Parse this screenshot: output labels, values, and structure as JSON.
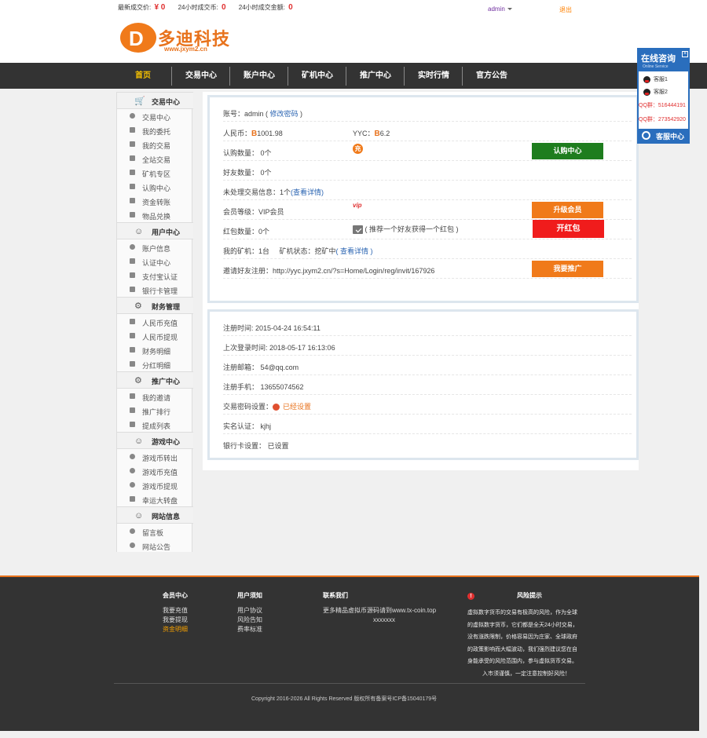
{
  "topbar": {
    "last_price_label": "最新成交价:",
    "last_price_value": "¥ 0",
    "volume_label": "24小时成交币:",
    "volume_value": "0",
    "amount_label": "24小时成交金额:",
    "amount_value": "0",
    "username": "admin",
    "logout": "退出"
  },
  "logo": {
    "letter": "D",
    "name": "多迪科技",
    "url": "www.jxym2.cn"
  },
  "nav": {
    "items": [
      "首页",
      "交易中心",
      "账户中心",
      "矿机中心",
      "推广中心",
      "实时行情",
      "官方公告"
    ]
  },
  "sidebar": {
    "sections": [
      {
        "title": "交易中心",
        "icon": "cart-icon",
        "items": [
          "交易中心",
          "我的委托",
          "我的交易",
          "全站交易",
          "矿机专区",
          "认购中心",
          "资金转账",
          "物品兑换"
        ]
      },
      {
        "title": "用户中心",
        "icon": "user-icon",
        "items": [
          "账户信息",
          "认证中心",
          "支付宝认证",
          "银行卡管理"
        ]
      },
      {
        "title": "财务管理",
        "icon": "gear-icon",
        "items": [
          "人民币充值",
          "人民币提现",
          "财务明细",
          "分红明细"
        ]
      },
      {
        "title": "推广中心",
        "icon": "gear-icon",
        "items": [
          "我的邀请",
          "推广排行",
          "提成列表"
        ]
      },
      {
        "title": "游戏中心",
        "icon": "user-icon",
        "items": [
          "游戏币转出",
          "游戏币充值",
          "游戏币提现",
          "幸运大转盘"
        ]
      },
      {
        "title": "网站信息",
        "icon": "user-icon",
        "items": [
          "留言板",
          "网站公告"
        ]
      }
    ]
  },
  "account": {
    "account_label": "账号：admin",
    "change_password": "修改密码",
    "rmb_label": "人民币：",
    "rmb_value": "1001.98",
    "yyc_label": "YYC：",
    "yyc_value": "6.2",
    "buy_count": "认购数量： 0个",
    "charge_badge": "充",
    "buy_center_btn": "认购中心",
    "friends_count": "好友数量： 0个",
    "pending_msgs": "未处理交易信息：1个",
    "view_details": "(查看详情)",
    "member_level": "会员等级：VIP会员",
    "vip_tag": "vip",
    "upgrade_btn": "升级会员",
    "redpack_count": "红包数量：0个",
    "redpack_hint": "( 推荐一个好友获得一个红包 )",
    "redpack_btn": "开红包",
    "my_miners": "我的矿机：1台",
    "miner_status": "矿机状态：挖矿中",
    "miner_details": "( 查看详情 )",
    "invite_label": "邀请好友注册：http://yyc.jxym2.cn/?s=Home/Login/reg/invit/167926",
    "promote_btn": "我要推广"
  },
  "profile": {
    "register_time": "注册时间: 2015-04-24 16:54:11",
    "last_login": "上次登录时间: 2018-05-17 16:13:06",
    "email": "注册邮箱： 54@qq.com",
    "phone": "注册手机： 13655074562",
    "trade_pwd_label": "交易密码设置：",
    "trade_pwd_status": "已经设置",
    "realname": "实名认证： kjhj",
    "bankcard": "银行卡设置： 已设置"
  },
  "consult": {
    "title": "在线咨询",
    "subtitle": "Online Service",
    "close": "×",
    "agents": [
      "客服1",
      "客服2"
    ],
    "groups": [
      "QQ群：516444191",
      "QQ群：273542920"
    ],
    "footer": "客服中心"
  },
  "footer": {
    "cols": [
      {
        "title": "会员中心",
        "links": [
          "我要充值",
          "我要提现",
          "资金明细"
        ]
      },
      {
        "title": "用户须知",
        "links": [
          "用户协议",
          "风险告知",
          "费率标准"
        ]
      },
      {
        "title": "联系我们",
        "links": [
          "更多精品虚拟币源码请到www.tx-coin.top",
          "xxxxxxx"
        ]
      }
    ],
    "risk_icon": "!",
    "risk_title": "风险提示",
    "risk_lines": [
      "虚拟数字货币的交易有极高的风险，作为全球",
      "的虚拟数字货币，它们都是全天24小时交易，",
      "没有涨跌限制，价格容易因为庄家、全球政府",
      "的政策影响而大幅波动，我们强烈建议您在自",
      "身能承受的风险范围内，参与虚拟货币交易。"
    ],
    "risk_last": "入市须谨慎，一定注意控制好风险！",
    "copyright": "Copyright 2016-2026 All Rights Reserved 版权所有备案号ICP备15040179号"
  },
  "colors": {
    "accent": "#f07a1a",
    "nav_bg": "#333333",
    "nav_active": "#f5c000",
    "link": "#2a64b2",
    "green_btn": "#1e7d1e",
    "red_btn": "#f01c1c"
  }
}
